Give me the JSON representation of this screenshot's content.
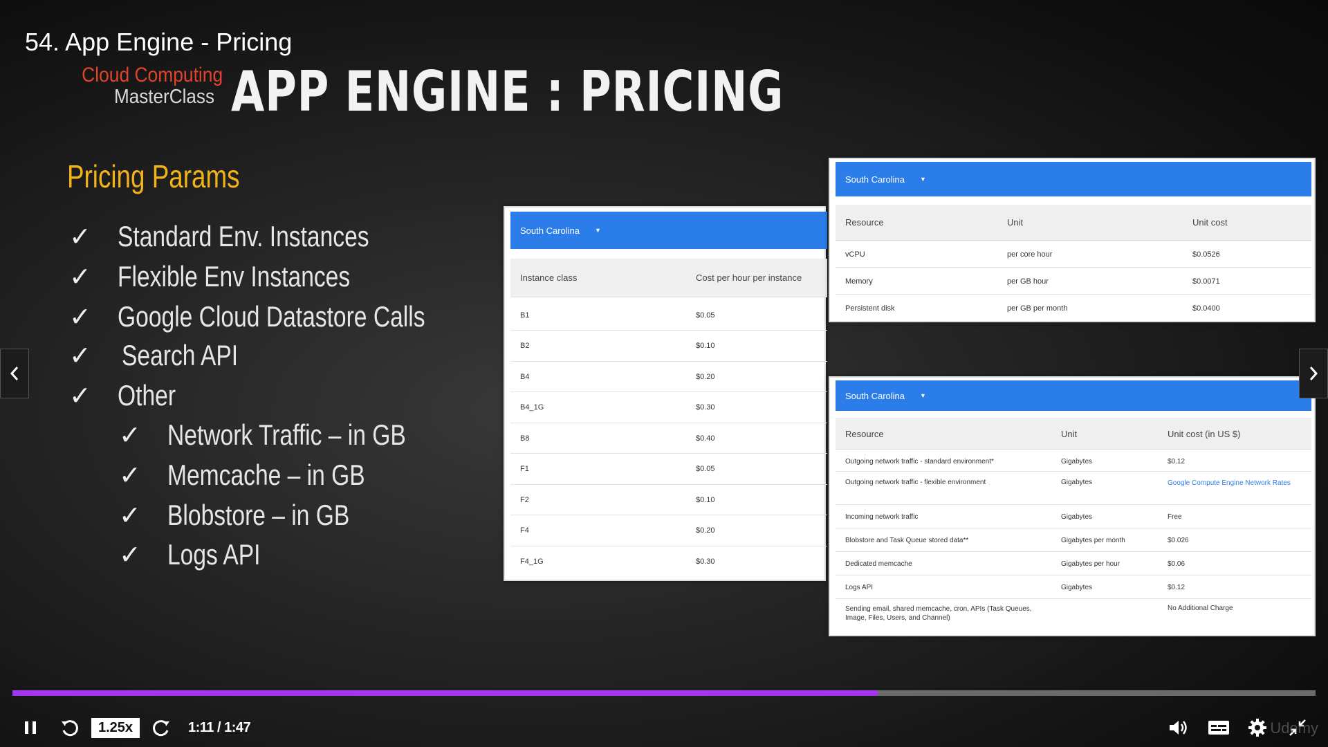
{
  "player": {
    "lecture_title": "54. App Engine - Pricing",
    "progress_fraction": 0.664,
    "speed": "1.25x",
    "time": "1:11 / 1:47",
    "watermark": "Udemy",
    "colors": {
      "accent": "#a435f0",
      "track": "#6b6b6b"
    },
    "icons": [
      "pause-icon",
      "rewind-icon",
      "forward-icon",
      "volume-icon",
      "captions-icon",
      "settings-icon",
      "exit-fullscreen-icon",
      "chevron-left-icon",
      "chevron-right-icon"
    ]
  },
  "slide": {
    "brand_line1": "Cloud Computing",
    "brand_line2": "MasterClass",
    "heading": "APP ENGINE : PRICING",
    "params_title": "Pricing Params",
    "params": [
      {
        "label": "Standard Env. Instances"
      },
      {
        "label": "Flexible Env Instances"
      },
      {
        "label": "Google Cloud Datastore Calls"
      },
      {
        "label": "Search API"
      },
      {
        "label": "Other"
      }
    ],
    "sub_params": [
      {
        "label": "Network Traffic – in GB"
      },
      {
        "label": "Memcache – in GB"
      },
      {
        "label": "Blobstore – in GB"
      },
      {
        "label": "Logs API"
      }
    ],
    "colors": {
      "heading": "#f2f2f2",
      "params_title": "#f1b318",
      "brand": "#e2432a",
      "table_bar": "#2b7de9"
    }
  },
  "instance_table": {
    "region": "South Carolina",
    "headers": [
      "Instance class",
      "Cost per hour per instance"
    ],
    "rows": [
      [
        "B1",
        "$0.05"
      ],
      [
        "B2",
        "$0.10"
      ],
      [
        "B4",
        "$0.20"
      ],
      [
        "B4_1G",
        "$0.30"
      ],
      [
        "B8",
        "$0.40"
      ],
      [
        "F1",
        "$0.05"
      ],
      [
        "F2",
        "$0.10"
      ],
      [
        "F4",
        "$0.20"
      ],
      [
        "F4_1G",
        "$0.30"
      ]
    ]
  },
  "resource_table": {
    "region": "South Carolina",
    "headers": [
      "Resource",
      "Unit",
      "Unit cost"
    ],
    "rows": [
      [
        "vCPU",
        "per core hour",
        "$0.0526"
      ],
      [
        "Memory",
        "per GB hour",
        "$0.0071"
      ],
      [
        "Persistent disk",
        "per GB per month",
        "$0.0400"
      ]
    ]
  },
  "other_table": {
    "region": "South Carolina",
    "headers": [
      "Resource",
      "Unit",
      "Unit cost (in US $)"
    ],
    "rows": [
      [
        "Outgoing network traffic - standard environment*",
        "Gigabytes",
        "$0.12"
      ],
      [
        "Outgoing network traffic - flexible environment",
        "Gigabytes",
        "Google Compute Engine Network Rates"
      ],
      [
        "Incoming network traffic",
        "Gigabytes",
        "Free"
      ],
      [
        "Blobstore and Task Queue stored data**",
        "Gigabytes per month",
        "$0.026"
      ],
      [
        "Dedicated memcache",
        "Gigabytes per hour",
        "$0.06"
      ],
      [
        "Logs API",
        "Gigabytes",
        "$0.12"
      ],
      [
        "Sending email, shared memcache, cron, APIs (Task Queues, Image, Files, Users, and Channel)",
        "",
        "No Additional Charge"
      ]
    ]
  }
}
